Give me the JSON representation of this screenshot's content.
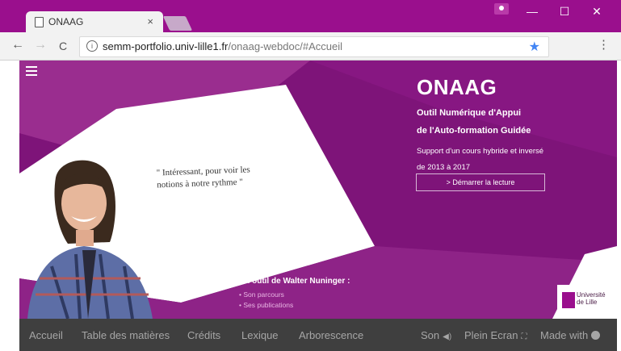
{
  "browser": {
    "tab_title": "ONAAG",
    "tab_close": "×",
    "url_host": "semm-portfolio.univ-lille1.fr",
    "url_path": "/onaag-webdoc/#Accueil",
    "back_icon": "←",
    "forward_icon": "→",
    "reload_icon": "C",
    "info_icon": "i",
    "star_icon": "★",
    "menu_icon": "⋮",
    "minimize": "—",
    "maximize": "☐",
    "close": "✕",
    "accent": "#9a0f8d"
  },
  "hero": {
    "title": "ONAAG",
    "subtitle_line1": "Outil Numérique d'Appui",
    "subtitle_line2": "de l'Auto-formation Guidée",
    "description": "Support d'un cours hybride et inversé de 2013 à 2017",
    "start_button": "> Démarrer la lecture",
    "quote": "\" Intéressant, pour voir les notions à notre rythme \""
  },
  "author": {
    "heading": "Un outil de Walter Nuninger :",
    "links": [
      "• Son parcours",
      "• Ses publications"
    ]
  },
  "logo_text": "Université de Lille",
  "bottom_nav": {
    "items": [
      "Accueil",
      "Table des matières",
      "Crédits",
      "Lexique",
      "Arborescence"
    ],
    "son": "Son",
    "fullscreen": "Plein Ecran",
    "made_with": "Made with"
  }
}
